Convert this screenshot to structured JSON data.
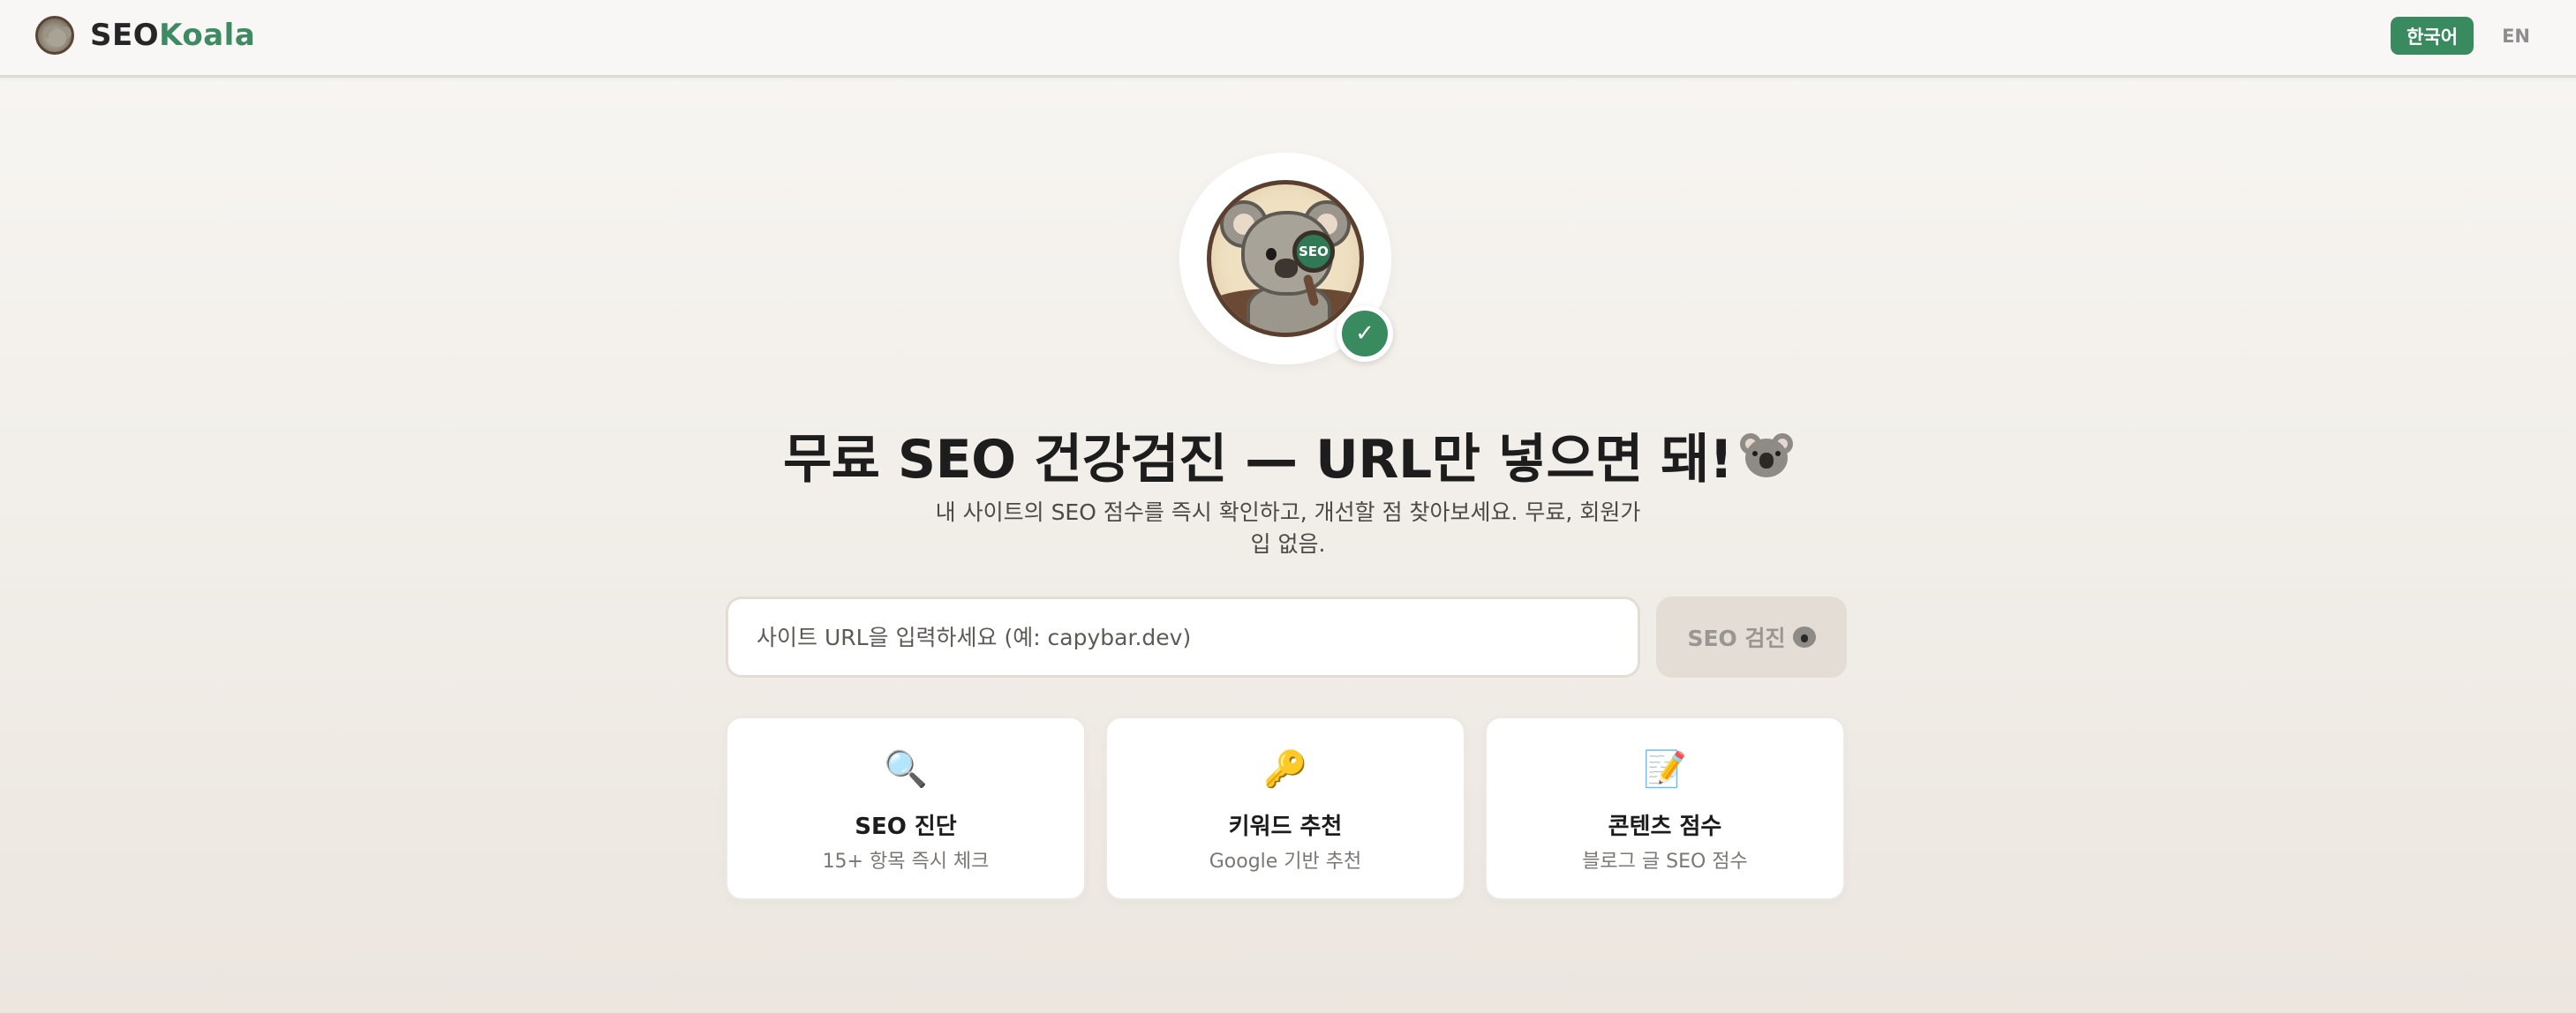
{
  "header": {
    "brand_seo": "SEO",
    "brand_koala": "Koala",
    "logo_icon": "koala-logo-icon",
    "lang_korean": "한국어",
    "lang_english": "EN",
    "active_lang": "한국어"
  },
  "hero": {
    "mascot_icon": "koala-magnifier-mascot-icon",
    "lens_label": "SEO",
    "check_icon": "checkmark-icon",
    "check_glyph": "✓",
    "title": "무료 SEO 건강검진 — URL만 넣으면 돼!",
    "title_emoji_icon": "koala-emoji-icon",
    "subtitle": "내 사이트의 SEO 점수를 즉시 확인하고, 개선할 점 찾아보세요. 무료, 회원가입 없음."
  },
  "search": {
    "value": "",
    "placeholder": "사이트 URL을 입력하세요 (예: capybar.dev)",
    "button_label": "SEO 검진",
    "button_icon": "koala-emoji-icon"
  },
  "features": [
    {
      "icon": "magnifier-icon",
      "glyph": "🔍",
      "title": "SEO 진단",
      "desc": "15+ 항목 즉시 체크"
    },
    {
      "icon": "key-icon",
      "glyph": "🔑",
      "title": "키워드 추천",
      "desc": "Google 기반 추천"
    },
    {
      "icon": "memo-icon",
      "glyph": "📝",
      "title": "콘텐츠 점수",
      "desc": "블로그 글 SEO 점수"
    }
  ],
  "colors": {
    "brand_green": "#3a8a60",
    "background": "#f4f1ed",
    "button_disabled": "#e3ddd6"
  }
}
